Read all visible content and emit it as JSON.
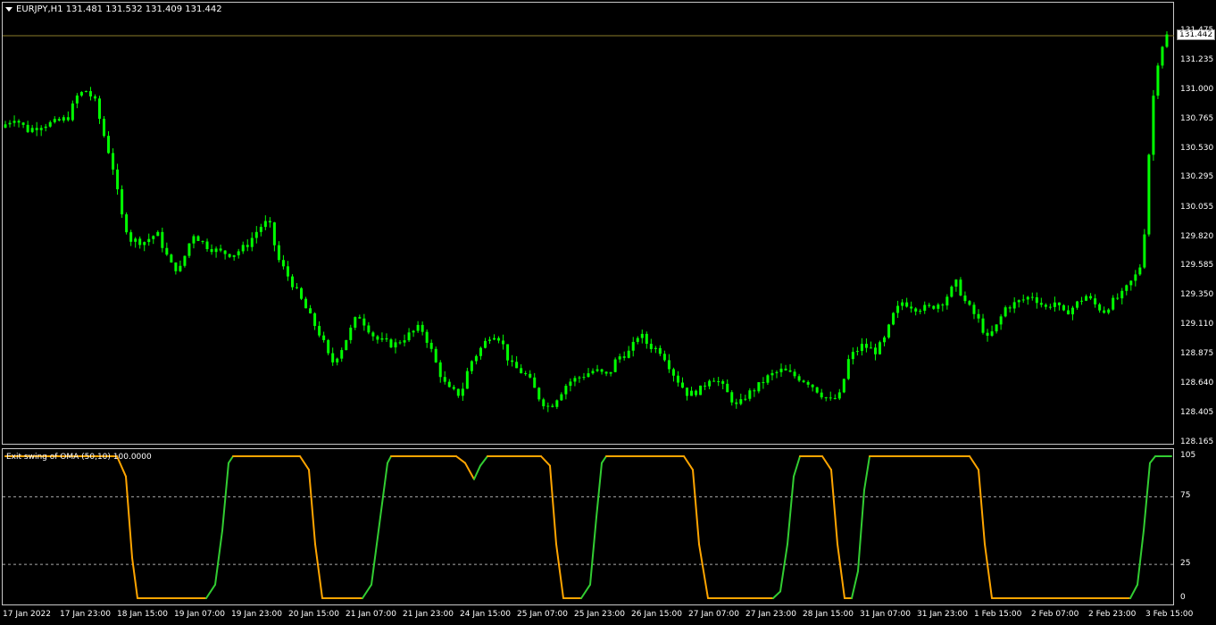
{
  "header": {
    "symbol_info": "EURJPY,H1  131.481 131.532 131.409 131.442"
  },
  "indicator": {
    "label": "Exit swing of OMA (50,10) 100.0000",
    "levels": [
      75,
      25
    ],
    "ylim": [
      0,
      105
    ],
    "color_up": "#32cd32",
    "color_down": "#ffa500"
  },
  "current_price": "131.442",
  "colors": {
    "candle": "#00ff00",
    "bid_line": "#8b7d2a",
    "grid": "#aaaaaa",
    "frame": "#c8c8c8"
  },
  "chart_data": {
    "type": "candlestick",
    "ylim": [
      128.165,
      131.475
    ],
    "y_ticks": [
      "131.475",
      "131.235",
      "131.000",
      "130.765",
      "130.530",
      "130.295",
      "130.055",
      "129.820",
      "129.585",
      "129.350",
      "129.110",
      "128.875",
      "128.640",
      "128.405",
      "128.165"
    ],
    "x_ticks": [
      "17 Jan 2022",
      "17 Jan 23:00",
      "18 Jan 15:00",
      "19 Jan 07:00",
      "19 Jan 23:00",
      "20 Jan 15:00",
      "21 Jan 07:00",
      "21 Jan 23:00",
      "24 Jan 15:00",
      "25 Jan 07:00",
      "25 Jan 23:00",
      "26 Jan 15:00",
      "27 Jan 07:00",
      "27 Jan 23:00",
      "28 Jan 15:00",
      "31 Jan 07:00",
      "31 Jan 23:00",
      "1 Feb 15:00",
      "2 Feb 07:00",
      "2 Feb 23:00",
      "3 Feb 15:00"
    ],
    "close_path": [
      [
        0,
        130.7
      ],
      [
        15,
        130.78
      ],
      [
        30,
        130.68
      ],
      [
        45,
        130.72
      ],
      [
        60,
        130.74
      ],
      [
        75,
        130.78
      ],
      [
        85,
        130.95
      ],
      [
        95,
        131.0
      ],
      [
        105,
        130.92
      ],
      [
        115,
        130.65
      ],
      [
        125,
        130.4
      ],
      [
        135,
        130.0
      ],
      [
        145,
        129.8
      ],
      [
        160,
        129.78
      ],
      [
        175,
        129.85
      ],
      [
        190,
        129.6
      ],
      [
        200,
        129.55
      ],
      [
        215,
        129.85
      ],
      [
        230,
        129.75
      ],
      [
        245,
        129.7
      ],
      [
        260,
        129.68
      ],
      [
        275,
        129.75
      ],
      [
        290,
        129.9
      ],
      [
        300,
        129.95
      ],
      [
        310,
        129.65
      ],
      [
        330,
        129.4
      ],
      [
        345,
        129.2
      ],
      [
        360,
        129.0
      ],
      [
        370,
        128.8
      ],
      [
        380,
        128.9
      ],
      [
        390,
        129.05
      ],
      [
        400,
        129.2
      ],
      [
        410,
        129.1
      ],
      [
        420,
        129.0
      ],
      [
        440,
        128.95
      ],
      [
        460,
        129.05
      ],
      [
        470,
        129.1
      ],
      [
        480,
        128.95
      ],
      [
        490,
        128.75
      ],
      [
        500,
        128.6
      ],
      [
        515,
        128.55
      ],
      [
        525,
        128.8
      ],
      [
        540,
        128.95
      ],
      [
        550,
        129.05
      ],
      [
        560,
        129.0
      ],
      [
        570,
        128.8
      ],
      [
        590,
        128.7
      ],
      [
        605,
        128.5
      ],
      [
        615,
        128.45
      ],
      [
        625,
        128.55
      ],
      [
        635,
        128.65
      ],
      [
        650,
        128.7
      ],
      [
        665,
        128.75
      ],
      [
        680,
        128.7
      ],
      [
        690,
        128.85
      ],
      [
        705,
        128.9
      ],
      [
        715,
        129.05
      ],
      [
        725,
        128.95
      ],
      [
        740,
        128.9
      ],
      [
        755,
        128.7
      ],
      [
        770,
        128.55
      ],
      [
        785,
        128.6
      ],
      [
        795,
        128.7
      ],
      [
        805,
        128.65
      ],
      [
        815,
        128.55
      ],
      [
        825,
        128.45
      ],
      [
        835,
        128.55
      ],
      [
        845,
        128.6
      ],
      [
        860,
        128.7
      ],
      [
        875,
        128.75
      ],
      [
        890,
        128.7
      ],
      [
        905,
        128.65
      ],
      [
        920,
        128.55
      ],
      [
        930,
        128.5
      ],
      [
        940,
        128.55
      ],
      [
        950,
        128.85
      ],
      [
        965,
        128.95
      ],
      [
        980,
        128.9
      ],
      [
        990,
        129.0
      ],
      [
        1000,
        129.2
      ],
      [
        1010,
        129.3
      ],
      [
        1025,
        129.25
      ],
      [
        1040,
        129.25
      ],
      [
        1055,
        129.3
      ],
      [
        1070,
        129.45
      ],
      [
        1080,
        129.3
      ],
      [
        1095,
        129.15
      ],
      [
        1105,
        129.0
      ],
      [
        1115,
        129.1
      ],
      [
        1125,
        129.25
      ],
      [
        1140,
        129.3
      ],
      [
        1155,
        129.35
      ],
      [
        1170,
        129.25
      ],
      [
        1180,
        129.3
      ],
      [
        1190,
        129.2
      ],
      [
        1200,
        129.25
      ],
      [
        1215,
        129.35
      ],
      [
        1225,
        129.28
      ],
      [
        1235,
        129.22
      ],
      [
        1245,
        129.3
      ],
      [
        1255,
        129.35
      ],
      [
        1265,
        129.45
      ],
      [
        1275,
        129.55
      ],
      [
        1280,
        129.75
      ],
      [
        1285,
        130.4
      ],
      [
        1290,
        130.9
      ],
      [
        1295,
        131.2
      ],
      [
        1300,
        131.35
      ],
      [
        1306,
        131.44
      ]
    ],
    "oscillator_path": [
      [
        0,
        105,
        "d"
      ],
      [
        125,
        105,
        "d"
      ],
      [
        135,
        90,
        "d"
      ],
      [
        142,
        30,
        "d"
      ],
      [
        148,
        0,
        "d"
      ],
      [
        225,
        0,
        "d"
      ],
      [
        235,
        10,
        "u"
      ],
      [
        243,
        50,
        "u"
      ],
      [
        250,
        100,
        "u"
      ],
      [
        255,
        105,
        "u"
      ],
      [
        330,
        105,
        "d"
      ],
      [
        340,
        95,
        "d"
      ],
      [
        347,
        40,
        "d"
      ],
      [
        355,
        0,
        "d"
      ],
      [
        400,
        0,
        "d"
      ],
      [
        410,
        10,
        "u"
      ],
      [
        420,
        60,
        "u"
      ],
      [
        428,
        100,
        "u"
      ],
      [
        432,
        105,
        "u"
      ],
      [
        505,
        105,
        "d"
      ],
      [
        515,
        100,
        "d"
      ],
      [
        525,
        88,
        "d"
      ],
      [
        532,
        98,
        "u"
      ],
      [
        540,
        105,
        "u"
      ],
      [
        600,
        105,
        "d"
      ],
      [
        610,
        98,
        "d"
      ],
      [
        617,
        40,
        "d"
      ],
      [
        625,
        0,
        "d"
      ],
      [
        645,
        0,
        "d"
      ],
      [
        655,
        10,
        "u"
      ],
      [
        662,
        60,
        "u"
      ],
      [
        668,
        100,
        "u"
      ],
      [
        673,
        105,
        "u"
      ],
      [
        760,
        105,
        "d"
      ],
      [
        770,
        95,
        "d"
      ],
      [
        777,
        40,
        "d"
      ],
      [
        787,
        0,
        "d"
      ],
      [
        860,
        0,
        "d"
      ],
      [
        868,
        5,
        "u"
      ],
      [
        876,
        40,
        "u"
      ],
      [
        883,
        90,
        "u"
      ],
      [
        890,
        105,
        "u"
      ],
      [
        915,
        105,
        "d"
      ],
      [
        925,
        95,
        "d"
      ],
      [
        932,
        40,
        "d"
      ],
      [
        940,
        0,
        "d"
      ],
      [
        948,
        0,
        "d"
      ],
      [
        955,
        20,
        "u"
      ],
      [
        962,
        80,
        "u"
      ],
      [
        968,
        105,
        "u"
      ],
      [
        1080,
        105,
        "d"
      ],
      [
        1090,
        95,
        "d"
      ],
      [
        1097,
        40,
        "d"
      ],
      [
        1105,
        0,
        "d"
      ],
      [
        1260,
        0,
        "d"
      ],
      [
        1268,
        10,
        "u"
      ],
      [
        1275,
        50,
        "u"
      ],
      [
        1282,
        100,
        "u"
      ],
      [
        1288,
        105,
        "u"
      ],
      [
        1306,
        105,
        "u"
      ]
    ]
  }
}
